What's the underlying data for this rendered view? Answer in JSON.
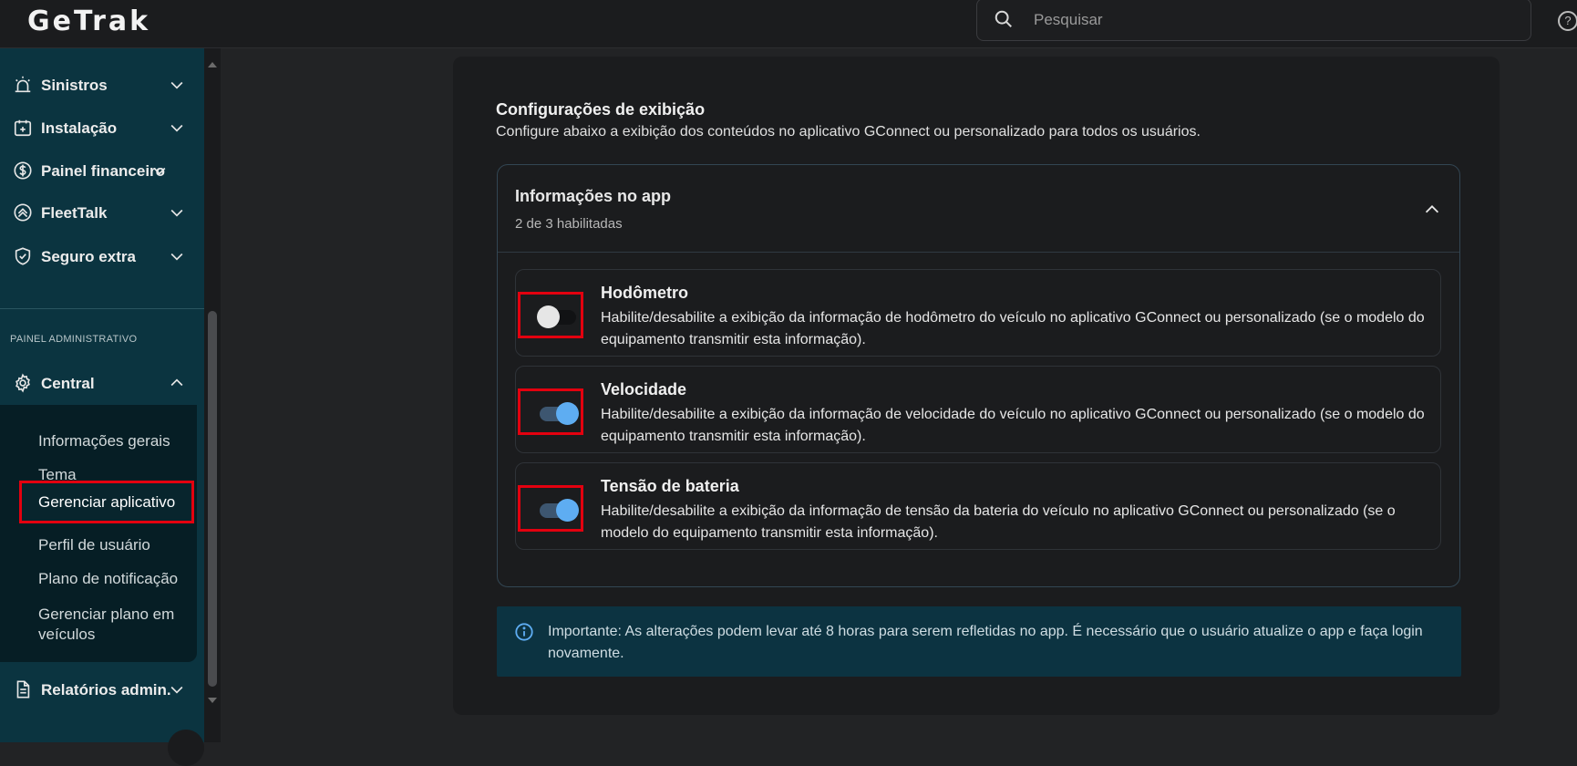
{
  "app": {
    "logo": "GeTrak"
  },
  "search": {
    "placeholder": "Pesquisar"
  },
  "sidebar": {
    "items": [
      {
        "label": "Sinistros",
        "icon": "alarm-icon"
      },
      {
        "label": "Instalação",
        "icon": "calendar-add-icon"
      },
      {
        "label": "Painel financeiro",
        "icon": "dollar-circle-icon"
      },
      {
        "label": "FleetTalk",
        "icon": "fleettalk-icon"
      },
      {
        "label": "Seguro extra",
        "icon": "shield-check-icon"
      }
    ],
    "section_label": "PAINEL ADMINISTRATIVO",
    "central": {
      "label": "Central",
      "icon": "gear-icon"
    },
    "central_sub": [
      "Informações gerais",
      "Tema",
      "Gerenciar aplicativo",
      "Perfil de usuário",
      "Plano de notificação",
      "Gerenciar plano em veículos"
    ],
    "reports": {
      "label": "Relatórios admin.",
      "icon": "document-icon"
    }
  },
  "main": {
    "title": "Configurações de exibição",
    "subtitle": "Configure abaixo a exibição dos conteúdos no aplicativo GConnect ou personalizado para todos os usuários.",
    "accordion": {
      "title": "Informações no app",
      "summary": "2 de 3 habilitadas",
      "items": [
        {
          "name": "Hodômetro",
          "enabled": false,
          "description": "Habilite/desabilite a exibição da informação de hodômetro do veículo no aplicativo GConnect ou personalizado (se o modelo do equipamento transmitir esta informação)."
        },
        {
          "name": "Velocidade",
          "enabled": true,
          "description": "Habilite/desabilite a exibição da informação de velocidade do veículo no aplicativo GConnect ou personalizado (se o modelo do equipamento transmitir esta informação)."
        },
        {
          "name": "Tensão de bateria",
          "enabled": true,
          "description": "Habilite/desabilite a exibição da informação de tensão da bateria do veículo no aplicativo GConnect ou personalizado (se o modelo do equipamento transmitir esta informação)."
        }
      ]
    },
    "notice": "Importante: As alterações podem levar até 8 horas para serem refletidas no app. É necessário que o usuário atualize o app e faça login novamente."
  },
  "colors": {
    "sidebar": "#0b3440",
    "accent": "#5eadf2",
    "highlight": "#e3000f",
    "notice": "#0c3341"
  }
}
